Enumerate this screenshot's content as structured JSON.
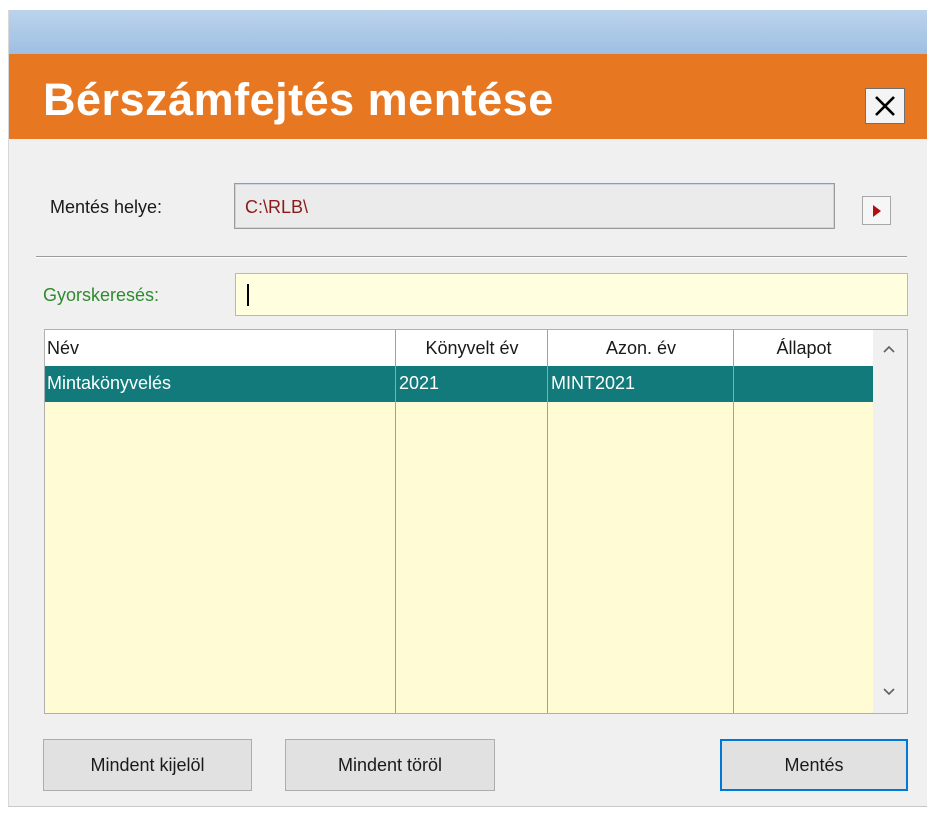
{
  "dialog": {
    "title": "Bérszámfejtés mentése",
    "close_label": "✕"
  },
  "location": {
    "label": "Mentés helye:",
    "value": "C:\\RLB\\"
  },
  "search": {
    "label": "Gyorskeresés:",
    "value": ""
  },
  "table": {
    "columns": [
      "Név",
      "Könyvelt év",
      "Azon. év",
      "Állapot"
    ],
    "rows": [
      {
        "nev": "Mintakönyvelés",
        "konyvelt_ev": "2021",
        "azon_ev": "MINT2021",
        "allapot": ""
      }
    ]
  },
  "buttons": {
    "select_all": "Mindent kijelöl",
    "clear_all": "Mindent töröl",
    "save": "Mentés"
  },
  "colors": {
    "title_bar": "#e87722",
    "selected_row": "#127a7a",
    "list_background": "#fffcd5",
    "search_label": "#2e8b2e"
  }
}
